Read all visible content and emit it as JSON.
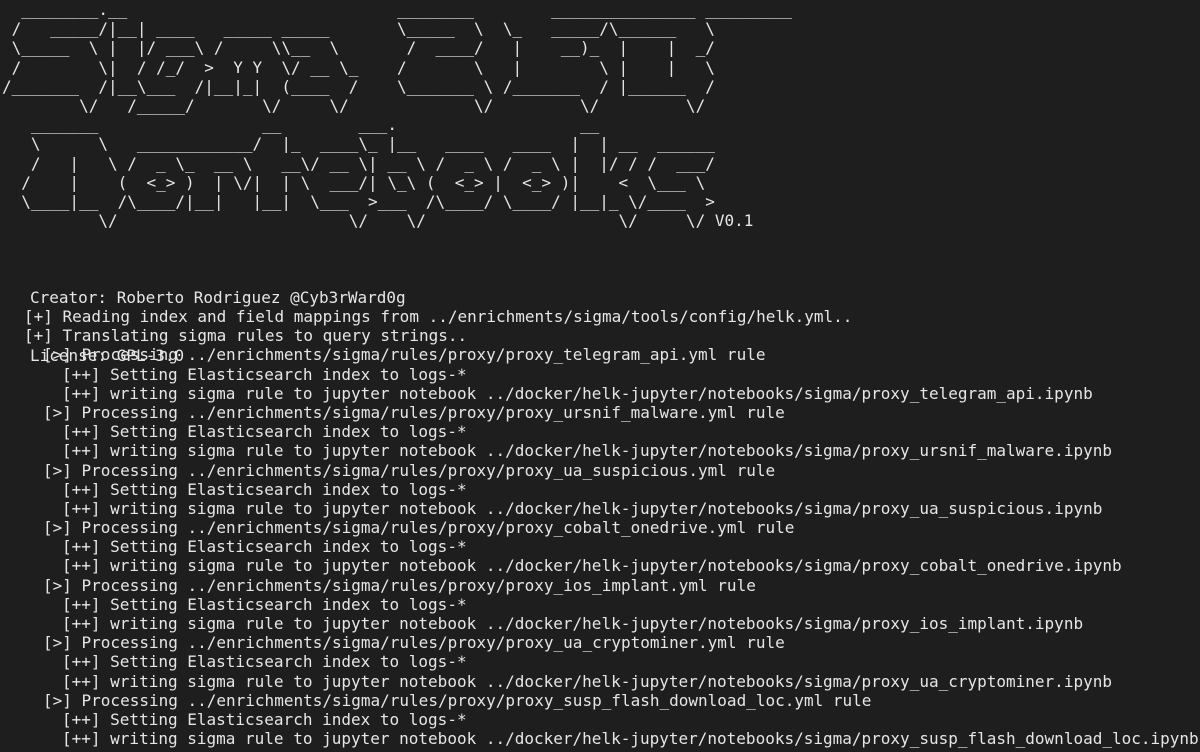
{
  "banner": {
    "ascii_lines": [
      "  ________.__                            ________        _______________ _________",
      " /   _____/|__| ____   _____ _____       \\_____  \\  \\_   _____/\\______   \\",
      " \\_____  \\ |  |/ ___\\ /     \\\\__  \\       /  ____/   |    __)_  |    |  _/",
      " /        \\|  / /_/  >  Y Y  \\/ __ \\_    /       \\   |        \\ |    |   \\",
      "/_______  /|__\\___  /|__|_|  (____  /    \\_______ \\ /_______  / |______  /",
      "        \\/   /_____/       \\/     \\/             \\/         \\/         \\/",
      "   _______                 __        ___.                   __",
      "   \\      \\   ____________/  |_  ____\\_ |__   ____   ____  |  | __  ______",
      "   /   |   \\ /  _ \\_  __ \\   __\\/ __ \\| __ \\ /  _ \\ /  _ \\ |  |/ / /  ___/",
      "  /    |    (  <_> )  | \\/|  | \\  ___/| \\_\\ (  <_> |  <_> )|    <  \\___ \\",
      "  \\____|__  /\\____/|__|   |__|  \\___  >___  /\\____/ \\____/ |__|_ \\/____  >",
      "          \\/                        \\/    \\/                    \\/     \\/"
    ],
    "version": "V0.1"
  },
  "meta": {
    "creator": "Creator: Roberto Rodriguez @Cyb3rWard0g",
    "license": "License: GPL-3.0"
  },
  "log": [
    {
      "indent": 0,
      "text": "[+] Reading index and field mappings from ../enrichments/sigma/tools/config/helk.yml.."
    },
    {
      "indent": 0,
      "text": "[+] Translating sigma rules to query strings.."
    },
    {
      "indent": 1,
      "text": "[>] Processing ../enrichments/sigma/rules/proxy/proxy_telegram_api.yml rule"
    },
    {
      "indent": 2,
      "text": "[++] Setting Elasticsearch index to logs-*"
    },
    {
      "indent": 2,
      "text": "[++] writing sigma rule to jupyter notebook ../docker/helk-jupyter/notebooks/sigma/proxy_telegram_api.ipynb"
    },
    {
      "indent": 1,
      "text": "[>] Processing ../enrichments/sigma/rules/proxy/proxy_ursnif_malware.yml rule"
    },
    {
      "indent": 2,
      "text": "[++] Setting Elasticsearch index to logs-*"
    },
    {
      "indent": 2,
      "text": "[++] writing sigma rule to jupyter notebook ../docker/helk-jupyter/notebooks/sigma/proxy_ursnif_malware.ipynb"
    },
    {
      "indent": 1,
      "text": "[>] Processing ../enrichments/sigma/rules/proxy/proxy_ua_suspicious.yml rule"
    },
    {
      "indent": 2,
      "text": "[++] Setting Elasticsearch index to logs-*"
    },
    {
      "indent": 2,
      "text": "[++] writing sigma rule to jupyter notebook ../docker/helk-jupyter/notebooks/sigma/proxy_ua_suspicious.ipynb"
    },
    {
      "indent": 1,
      "text": "[>] Processing ../enrichments/sigma/rules/proxy/proxy_cobalt_onedrive.yml rule"
    },
    {
      "indent": 2,
      "text": "[++] Setting Elasticsearch index to logs-*"
    },
    {
      "indent": 2,
      "text": "[++] writing sigma rule to jupyter notebook ../docker/helk-jupyter/notebooks/sigma/proxy_cobalt_onedrive.ipynb"
    },
    {
      "indent": 1,
      "text": "[>] Processing ../enrichments/sigma/rules/proxy/proxy_ios_implant.yml rule"
    },
    {
      "indent": 2,
      "text": "[++] Setting Elasticsearch index to logs-*"
    },
    {
      "indent": 2,
      "text": "[++] writing sigma rule to jupyter notebook ../docker/helk-jupyter/notebooks/sigma/proxy_ios_implant.ipynb"
    },
    {
      "indent": 1,
      "text": "[>] Processing ../enrichments/sigma/rules/proxy/proxy_ua_cryptominer.yml rule"
    },
    {
      "indent": 2,
      "text": "[++] Setting Elasticsearch index to logs-*"
    },
    {
      "indent": 2,
      "text": "[++] writing sigma rule to jupyter notebook ../docker/helk-jupyter/notebooks/sigma/proxy_ua_cryptominer.ipynb"
    },
    {
      "indent": 1,
      "text": "[>] Processing ../enrichments/sigma/rules/proxy/proxy_susp_flash_download_loc.yml rule"
    },
    {
      "indent": 2,
      "text": "[++] Setting Elasticsearch index to logs-*"
    },
    {
      "indent": 2,
      "text": "[++] writing sigma rule to jupyter notebook ../docker/helk-jupyter/notebooks/sigma/proxy_susp_flash_download_loc.ipynb"
    }
  ],
  "colors": {
    "background": "#1e1e1e",
    "foreground": "#e6e6e6"
  }
}
